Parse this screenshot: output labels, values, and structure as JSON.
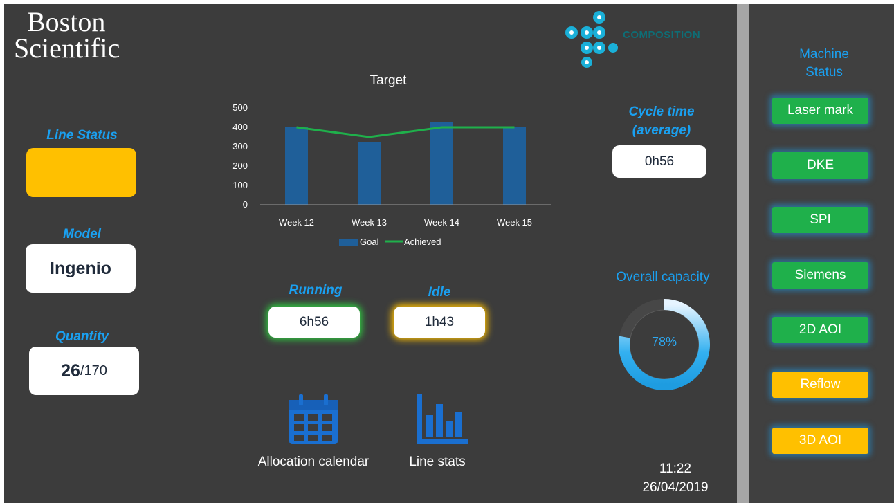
{
  "brand": {
    "line1": "Boston",
    "line2": "Scientific",
    "partner": "COMPOSITION"
  },
  "line_status": {
    "label": "Line Status",
    "color": "#ffc000"
  },
  "model": {
    "label": "Model",
    "value": "Ingenio"
  },
  "quantity": {
    "label": "Quantity",
    "done": "26",
    "total": "/170"
  },
  "chart": {
    "title": "Target"
  },
  "chart_data": {
    "type": "bar",
    "title": "Target",
    "categories": [
      "Week 12",
      "Week 13",
      "Week 14",
      "Week 15"
    ],
    "series": [
      {
        "name": "Goal",
        "type": "bar",
        "color": "#1f5f99",
        "values": [
          400,
          325,
          425,
          400
        ]
      },
      {
        "name": "Achieved",
        "type": "line",
        "color": "#1fb04b",
        "values": [
          400,
          350,
          400,
          400
        ]
      }
    ],
    "ylim": [
      0,
      500
    ],
    "yticks": [
      0,
      100,
      200,
      300,
      400,
      500
    ],
    "grid": false,
    "legend": "bottom"
  },
  "cycle_time": {
    "label_line1": "Cycle time",
    "label_line2": "(average)",
    "value": "0h56"
  },
  "running": {
    "label": "Running",
    "value": "6h56"
  },
  "idle": {
    "label": "Idle",
    "value": "1h43"
  },
  "capacity": {
    "label": "Overall capacity",
    "value": "78%",
    "fraction": 0.78
  },
  "nav": {
    "calendar_label": "Allocation calendar",
    "stats_label": "Line stats"
  },
  "clock": {
    "time": "11:22",
    "date": "26/04/2019"
  },
  "machine_status": {
    "title_line1": "Machine",
    "title_line2": "Status",
    "machines": [
      {
        "name": "Laser mark",
        "status": "green"
      },
      {
        "name": "DKE",
        "status": "green"
      },
      {
        "name": "SPI",
        "status": "green"
      },
      {
        "name": "Siemens",
        "status": "green"
      },
      {
        "name": "2D AOI",
        "status": "green"
      },
      {
        "name": "Reflow",
        "status": "yellow"
      },
      {
        "name": "3D AOI",
        "status": "yellow"
      }
    ]
  }
}
